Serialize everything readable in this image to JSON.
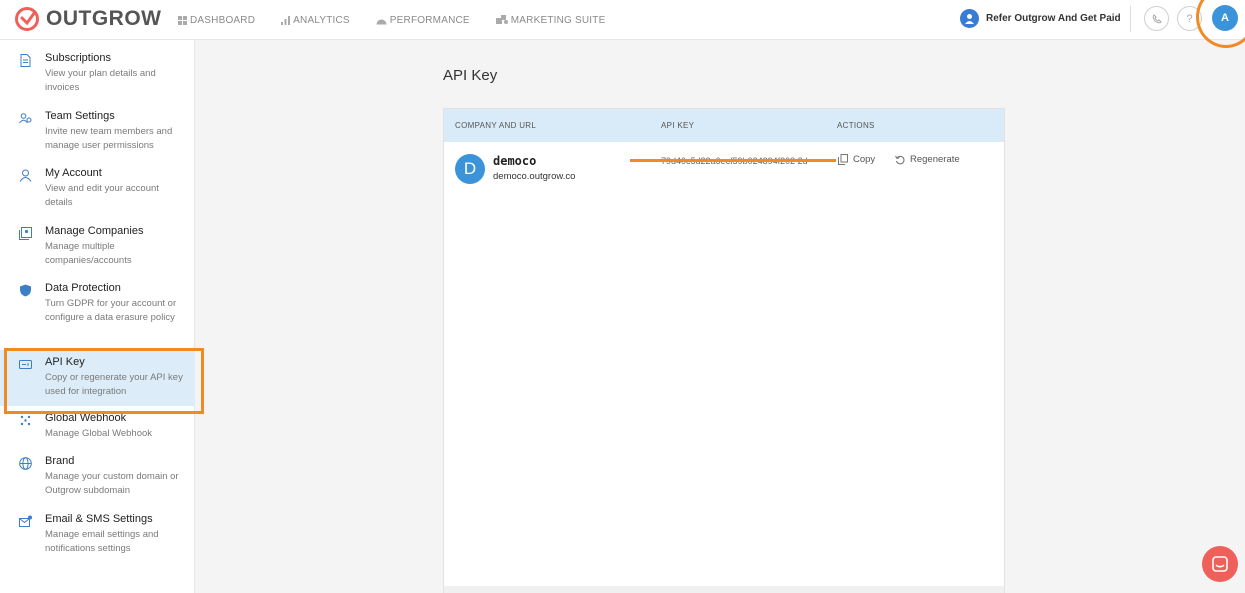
{
  "brand": {
    "name": "OUTGROW"
  },
  "nav": [
    {
      "label": "DASHBOARD",
      "icon": "grid-icon"
    },
    {
      "label": "ANALYTICS",
      "icon": "bar-chart-icon"
    },
    {
      "label": "PERFORMANCE",
      "icon": "gauge-icon"
    },
    {
      "label": "MARKETING SUITE",
      "icon": "puzzle-icon"
    }
  ],
  "header": {
    "refer_label": "Refer Outgrow And Get Paid",
    "phone_icon": "phone-icon",
    "help_label": "?",
    "avatar_initial": "A"
  },
  "sidebar": {
    "items": [
      {
        "title": "Subscriptions",
        "desc": "View your plan details and invoices",
        "icon": "document-icon"
      },
      {
        "title": "Team Settings",
        "desc": "Invite new team members and manage user permissions",
        "icon": "team-icon"
      },
      {
        "title": "My Account",
        "desc": "View and edit your account details",
        "icon": "user-icon"
      },
      {
        "title": "Manage Companies",
        "desc": "Manage multiple companies/accounts",
        "icon": "companies-icon"
      },
      {
        "title": "Data Protection",
        "desc": "Turn GDPR for your account or configure a data erasure policy",
        "icon": "shield-icon"
      },
      {
        "title": "API Key",
        "desc": "Copy or regenerate your API key used for integration",
        "icon": "api-key-icon",
        "active": true
      },
      {
        "title": "Global Webhook",
        "desc": "Manage Global Webhook",
        "icon": "webhook-icon"
      },
      {
        "title": "Brand",
        "desc": "Manage your custom domain or Outgrow subdomain",
        "icon": "globe-icon"
      },
      {
        "title": "Email & SMS Settings",
        "desc": "Manage email settings and notifications settings",
        "icon": "email-settings-icon"
      }
    ]
  },
  "main": {
    "title": "API Key",
    "table": {
      "headers": {
        "company": "COMPANY AND URL",
        "api_key": "API KEY",
        "actions": "ACTIONS"
      },
      "rows": [
        {
          "initial": "D",
          "company": "democo",
          "url": "democo.outgrow.co",
          "api_key": "79d40c5d22a6ecf59b024894f202 2d",
          "copy_label": "Copy",
          "regenerate_label": "Regenerate"
        }
      ]
    }
  },
  "colors": {
    "accent": "#3b94d9",
    "highlight": "#f08a24",
    "brand": "#f0605a",
    "header_bg": "#d9ebf8"
  }
}
